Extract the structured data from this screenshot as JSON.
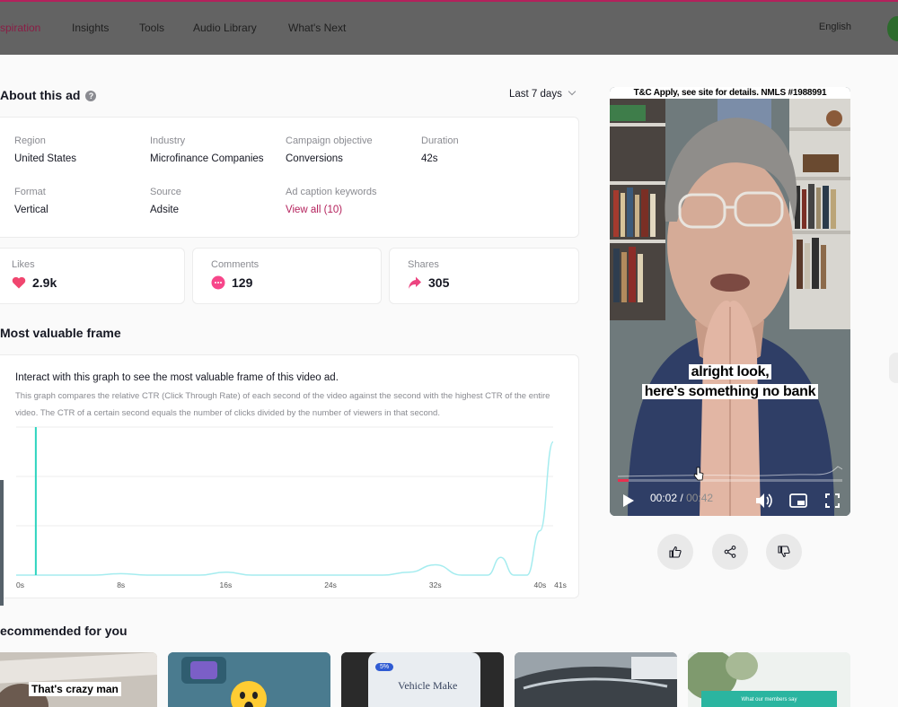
{
  "nav": {
    "items": [
      "spiration",
      "Insights",
      "Tools",
      "Audio Library",
      "What's Next"
    ],
    "language": "English"
  },
  "about": {
    "title": "About this ad",
    "period": "Last 7 days",
    "fields": {
      "region": {
        "label": "Region",
        "value": "United States"
      },
      "industry": {
        "label": "Industry",
        "value": "Microfinance Companies"
      },
      "objective": {
        "label": "Campaign objective",
        "value": "Conversions"
      },
      "duration": {
        "label": "Duration",
        "value": "42s"
      },
      "format": {
        "label": "Format",
        "value": "Vertical"
      },
      "source": {
        "label": "Source",
        "value": "Adsite"
      },
      "keywords": {
        "label": "Ad caption keywords",
        "value": "View all (10)"
      }
    }
  },
  "stats": {
    "likes": {
      "label": "Likes",
      "value": "2.9k",
      "icon": "heart-icon"
    },
    "comments": {
      "label": "Comments",
      "value": "129",
      "icon": "comment-bubble-icon"
    },
    "shares": {
      "label": "Shares",
      "value": "305",
      "icon": "share-arrow-icon"
    }
  },
  "frame": {
    "title": "Most valuable frame",
    "graph_title": "Interact with this graph to see the most valuable frame of this video ad.",
    "graph_desc": "This graph compares the relative CTR (Click Through Rate) of each second of the video against the second with the highest CTR of the entire video. The CTR of a certain second equals the number of clicks divided by the number of viewers in that second."
  },
  "chart_data": {
    "type": "area",
    "x_ticks": [
      "0s",
      "8s",
      "16s",
      "24s",
      "32s",
      "40s",
      "41s"
    ],
    "x": [
      0,
      2,
      4,
      6,
      8,
      10,
      12,
      14,
      16,
      18,
      20,
      22,
      24,
      26,
      28,
      30,
      32,
      34,
      36,
      37,
      38,
      39,
      40,
      41
    ],
    "values": [
      0,
      0,
      0,
      0,
      0.01,
      0,
      0,
      0,
      0.02,
      0,
      0,
      0,
      0,
      0,
      0,
      0.02,
      0.07,
      0,
      0,
      0.12,
      0,
      0,
      0.3,
      0.9
    ],
    "selected_x": 1.5,
    "ylim": [
      0,
      1
    ],
    "grid": true,
    "colors": {
      "line": "#a5ecef",
      "marker": "#2dd4bf"
    }
  },
  "video": {
    "top_caption": "T&C Apply, see site for details. NMLS #1988991",
    "subtitle_line1": "alright look,",
    "subtitle_line2": "here's something no bank",
    "current_time": "00:02",
    "separator": "/",
    "total_time": "00:42",
    "progress": 0.048
  },
  "recommended": {
    "title": "ecommended for you",
    "thumb1_text": "That's crazy man",
    "thumb3_badge": "5%",
    "thumb3_text": "Vehicle Make",
    "thumb5_text": "What our members say"
  },
  "colors": {
    "accent": "#b4215c",
    "like": "#fe2c55",
    "comment": "#f7468a",
    "share": "#ec4480"
  }
}
